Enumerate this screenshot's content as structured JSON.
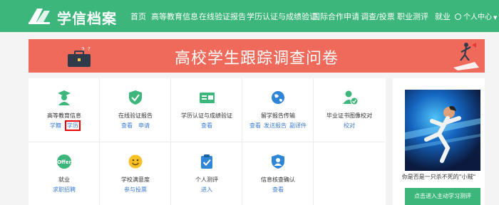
{
  "header": {
    "logo_text": "学信档案",
    "nav": [
      "首页",
      "高等教育信息",
      "在线验证报告",
      "学历认证与成绩验证",
      "国际合作申请",
      "调查/投票",
      "职业测评",
      "就业"
    ],
    "user_menu": "个人中心"
  },
  "banner": {
    "title": "高校学生跟踪调查问卷"
  },
  "services": [
    {
      "title": "高等教育信息",
      "icon": "graduate-icon",
      "links": [
        "学籍",
        "学历"
      ]
    },
    {
      "title": "在线验证报告",
      "icon": "shield-check-icon",
      "links": [
        "查看",
        "申请"
      ]
    },
    {
      "title": "学历认证与成绩验证",
      "icon": "id-card-icon",
      "links": [
        "查看"
      ]
    },
    {
      "title": "留学报告传输",
      "icon": "globe-icon",
      "links": [
        "查看",
        "发送报告",
        "副译件"
      ]
    },
    {
      "title": "毕业证书图像校对",
      "icon": "user-check-icon",
      "links": [
        "校对"
      ]
    },
    {
      "title": "就业",
      "icon": "offer-icon",
      "links": [
        "求职招聘"
      ]
    },
    {
      "title": "学校满意度",
      "icon": "smiley-icon",
      "links": [
        "参与投票"
      ]
    },
    {
      "title": "个人测评",
      "icon": "clipboard-icon",
      "links": [
        "进入"
      ]
    },
    {
      "title": "信息核查确认",
      "icon": "user-shield-icon",
      "links": [
        "查看"
      ]
    }
  ],
  "side": {
    "caption": "你是否是一只杀不死的\"小贼\"",
    "button": "点击进入主动学习测评"
  },
  "colors": {
    "primary": "#3cb67a",
    "banner": "#ef6a5b",
    "link": "#3a7bd5",
    "highlight": "#ee0000"
  }
}
